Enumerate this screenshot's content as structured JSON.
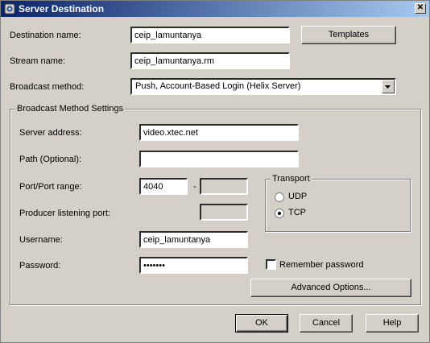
{
  "window": {
    "title": "Server Destination",
    "close_glyph": "✕"
  },
  "destination": {
    "label": "Destination name:",
    "value": "ceip_lamuntanya",
    "templates_button": "Templates"
  },
  "stream": {
    "label": "Stream name:",
    "value": "ceip_lamuntanya.rm"
  },
  "broadcast": {
    "label": "Broadcast method:",
    "value": "Push, Account-Based Login (Helix Server)"
  },
  "settings": {
    "group_label": "Broadcast Method Settings",
    "server_address_label": "Server address:",
    "server_address_value": "video.xtec.net",
    "path_label": "Path (Optional):",
    "path_value": "",
    "port_label": "Port/Port range:",
    "port_value": "4040",
    "port_dash": "-",
    "port_end_value": "",
    "producer_port_label": "Producer listening port:",
    "producer_port_value": "",
    "username_label": "Username:",
    "username_value": "ceip_lamuntanya",
    "password_label": "Password:",
    "password_value": "•••••••",
    "remember_label": "Remember password",
    "remember_checked": false,
    "advanced_button": "Advanced Options...",
    "transport": {
      "label": "Transport",
      "options": [
        "UDP",
        "TCP"
      ],
      "selected": "TCP"
    }
  },
  "footer": {
    "ok": "OK",
    "cancel": "Cancel",
    "help": "Help"
  },
  "icons": {
    "title_icon": "app-icon",
    "dropdown_arrow": "chevron-down-icon"
  }
}
